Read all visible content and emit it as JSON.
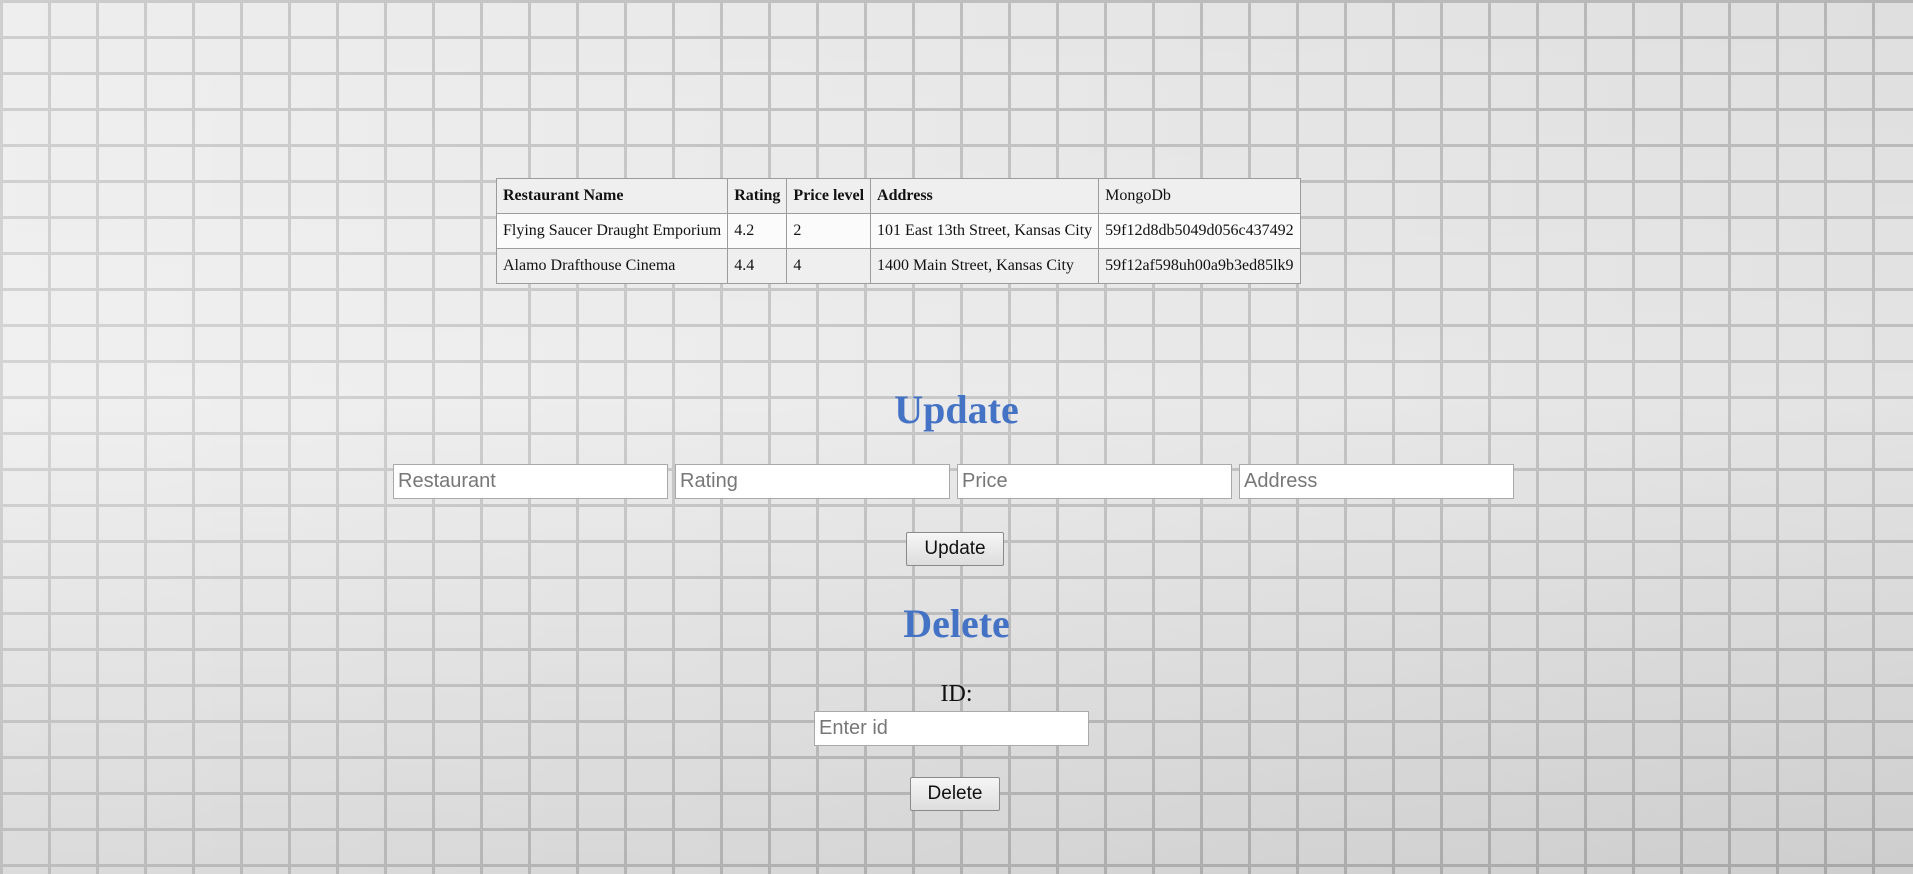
{
  "table": {
    "headers": [
      "Restaurant Name",
      "Rating",
      "Price level",
      "Address",
      "MongoDb"
    ],
    "rows": [
      [
        "Flying Saucer Draught Emporium",
        "4.2",
        "2",
        "101 East 13th Street, Kansas City",
        "59f12d8db5049d056c437492"
      ],
      [
        "Alamo Drafthouse Cinema",
        "4.4",
        "4",
        "1400 Main Street, Kansas City",
        "59f12af598uh00a9b3ed85lk9"
      ]
    ]
  },
  "update": {
    "title": "Update",
    "restaurant_placeholder": "Restaurant",
    "rating_placeholder": "Rating",
    "price_placeholder": "Price",
    "address_placeholder": "Address",
    "button_label": "Update"
  },
  "delete": {
    "title": "Delete",
    "id_label": "ID:",
    "id_placeholder": "Enter id",
    "button_label": "Delete"
  },
  "colors": {
    "heading": "#4472c4",
    "table_border": "#7b4a37"
  }
}
